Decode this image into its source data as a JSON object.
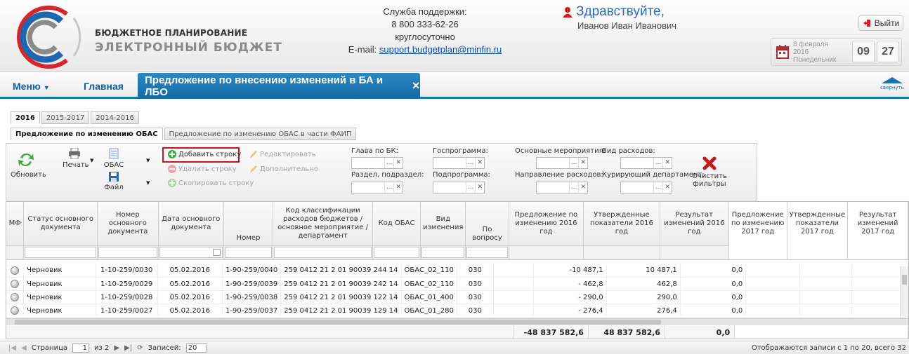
{
  "header": {
    "brand_line1": "БЮДЖЕТНОЕ ПЛАНИРОВАНИЕ",
    "brand_line2": "ЭЛЕКТРОННЫЙ БЮДЖЕТ",
    "support_title": "Служба поддержки:",
    "support_phone": "8 800 333-62-26",
    "support_hours": "круглосуточно",
    "support_email_label": "E-mail:",
    "support_email": "support.budgetplan@minfin.ru",
    "greeting": "Здравствуйте,",
    "user_name": "Иванов Иван Иванович",
    "logout_label": "Выйти",
    "date_day": "8 февраля",
    "date_year": "2016",
    "date_weekday": "Понедельник",
    "time_hour": "09",
    "time_minute": "27"
  },
  "nav": {
    "menu_label": "Меню",
    "main_label": "Главная",
    "active_tab": "Предложение по внесению изменений в БА и ЛБО",
    "collapse_label": "свернуть"
  },
  "year_tabs": [
    "2016",
    "2015-2017",
    "2014-2016"
  ],
  "sub_tabs": [
    "Предложение по изменению ОБАС",
    "Предложение по изменению ОБАС в части ФАИП"
  ],
  "toolbar": {
    "refresh": "Обновить",
    "print": "Печать",
    "obas": "ОБАС",
    "file": "Файл",
    "add_row": "Добавить строку",
    "delete_row": "Удалить строку",
    "copy_row": "Скопировать строку",
    "edit": "Редактировать",
    "extra": "Дополнительно",
    "clear_filters": "Очистить фильтры"
  },
  "filters": {
    "glava": "Глава по БК:",
    "razdel": "Раздел, подраздел:",
    "gosprog": "Госпрограмма:",
    "podprog": "Подпрограмма:",
    "main_events": "Основные мероприятия:",
    "direction": "Направление расходов:",
    "expense_type": "Вид расходов:",
    "department": "Курирующий департамент:"
  },
  "columns": [
    "МФ",
    "Статус основного документа",
    "Номер основного документа",
    "Дата основного документа",
    "Номер",
    "Код классификации расходов бюджетов / основное мероприятие / департамент",
    "Код ОБАС",
    "Вид изменения",
    "По вопросу",
    "Предложение по изменению 2016 год",
    "Утвержденные показатели 2016 год",
    "Результат изменений 2016 год",
    "Предложение по изменению 2017 год",
    "Утвержденные показатели 2017 год",
    "Результат изменений 2017 год"
  ],
  "rows": [
    {
      "status": "Черновик",
      "doc_num": "1-10-259/0030",
      "date": "05.02.2016",
      "num": "1-90-259/0040",
      "code": "259 0412 21 2 01 90039 244 14",
      "obas": "ОБАС_02_110",
      "vid": "030",
      "proposal": "-10 487,1",
      "approved": "10 487,1",
      "result": "0,0"
    },
    {
      "status": "Черновик",
      "doc_num": "1-10-259/0029",
      "date": "05.02.2016",
      "num": "1-90-259/0039",
      "code": "259 0412 21 2 01 90039 242 14",
      "obas": "ОБАС_02_110",
      "vid": "030",
      "proposal": "- 462,8",
      "approved": "462,8",
      "result": "0,0"
    },
    {
      "status": "Черновик",
      "doc_num": "1-10-259/0028",
      "date": "05.02.2016",
      "num": "1-90-259/0038",
      "code": "259 0412 21 2 01 90039 122 14",
      "obas": "ОБАС_01_400",
      "vid": "030",
      "proposal": "- 290,0",
      "approved": "290,0",
      "result": "0,0"
    },
    {
      "status": "Черновик",
      "doc_num": "1-10-259/0027",
      "date": "05.02.2016",
      "num": "1-90-259/0037",
      "code": "259 0412 21 2 01 90039 129 14",
      "obas": "ОБАС_01_280",
      "vid": "030",
      "proposal": "- 276,4",
      "approved": "276,4",
      "result": "0,0"
    }
  ],
  "totals": {
    "proposal": "-48 837 582,6",
    "approved": "48 837 582,6",
    "result": "0,0"
  },
  "pager": {
    "page_label": "Страница",
    "page": "1",
    "of": "из 2",
    "records_label": "Записей:",
    "records": "20",
    "summary": "Отображаются записи с 1 по 20, всего 32"
  }
}
